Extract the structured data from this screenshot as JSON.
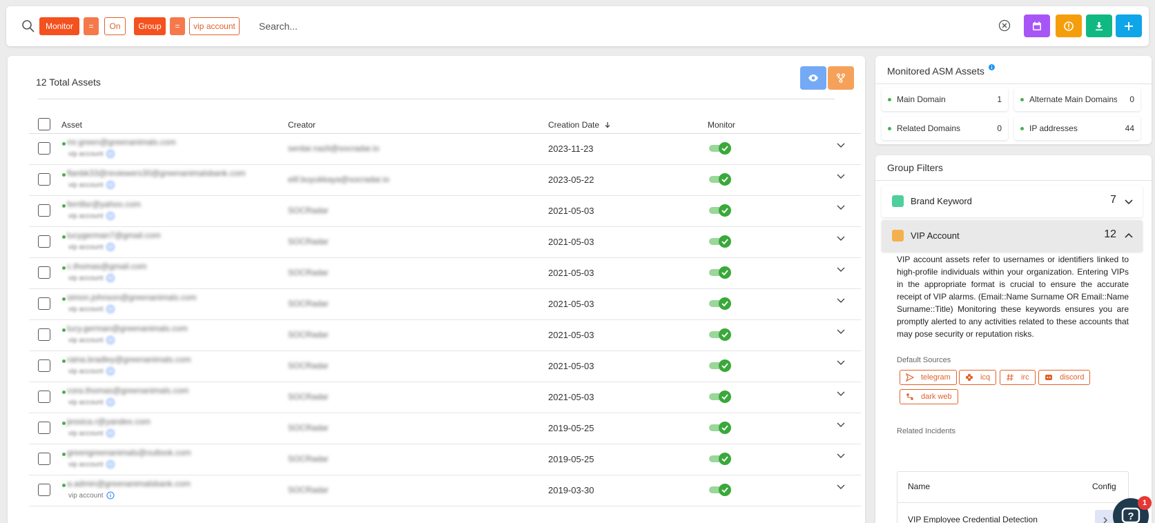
{
  "filter_bar": {
    "chips": [
      {
        "label": "Monitor",
        "style": "solid"
      },
      {
        "label": "=",
        "style": "eq"
      },
      {
        "label": "On",
        "style": "outline"
      },
      {
        "label": "Group",
        "style": "solid"
      },
      {
        "label": "=",
        "style": "eq"
      },
      {
        "label": "vip account",
        "style": "outline"
      }
    ],
    "search_placeholder": "Search...",
    "buttons": [
      {
        "name": "calendar-button",
        "icon": "calendar-icon",
        "color": "#a855f7"
      },
      {
        "name": "info-button",
        "icon": "info-icon",
        "color": "#f59e0b"
      },
      {
        "name": "download-button",
        "icon": "download-icon",
        "color": "#10b981"
      },
      {
        "name": "add-button",
        "icon": "plus-icon",
        "color": "#0ea5e9"
      }
    ]
  },
  "main": {
    "total_label": "12 Total Assets",
    "actions": [
      {
        "name": "view-button",
        "icon": "eye-icon",
        "color": "#74a9f5"
      },
      {
        "name": "branch-button",
        "icon": "fork-icon",
        "color": "#f6a15a"
      }
    ],
    "columns": {
      "asset": "Asset",
      "creator": "Creator",
      "creation_date": "Creation Date",
      "monitor": "Monitor"
    },
    "rows": [
      {
        "asset": "mr.green@greenanimals.com",
        "sub": "vip account",
        "creator": "serdar.nazli@socradar.io",
        "date": "2023-11-23"
      },
      {
        "asset": "flanbk33@reviewers30@greenanimalsbank.com",
        "sub": "vip account",
        "creator": "elif.buyukkaya@socradar.io",
        "date": "2023-05-22"
      },
      {
        "asset": "ferrillsr@yahoo.com",
        "sub": "vip account",
        "creator": "SOCRadar",
        "date": "2021-05-03"
      },
      {
        "asset": "lucygerman7@gmail.com",
        "sub": "vip account",
        "creator": "SOCRadar",
        "date": "2021-05-03"
      },
      {
        "asset": "c.thomas@gmail.com",
        "sub": "vip account",
        "creator": "SOCRadar",
        "date": "2021-05-03"
      },
      {
        "asset": "simon.johnson@greenanimals.com",
        "sub": "vip account",
        "creator": "SOCRadar",
        "date": "2021-05-03"
      },
      {
        "asset": "lucy.german@greenanimals.com",
        "sub": "vip account",
        "creator": "SOCRadar",
        "date": "2021-05-03"
      },
      {
        "asset": "raina.bradley@greenanimals.com",
        "sub": "vip account",
        "creator": "SOCRadar",
        "date": "2021-05-03"
      },
      {
        "asset": "cora.thomas@greenanimals.com",
        "sub": "vip account",
        "creator": "SOCRadar",
        "date": "2021-05-03"
      },
      {
        "asset": "jessica.r@yandex.com",
        "sub": "vip account",
        "creator": "SOCRadar",
        "date": "2019-05-25"
      },
      {
        "asset": "greengreenanimals@outlook.com",
        "sub": "vip account",
        "creator": "SOCRadar",
        "date": "2019-05-25"
      },
      {
        "asset": "a.admin@greenanimalsbank.com",
        "sub": "vip account",
        "creator": "SOCRadar",
        "date": "2019-03-30"
      }
    ]
  },
  "monitored": {
    "title": "Monitored ASM Assets",
    "stats": [
      {
        "label": "Main Domain",
        "value": "1"
      },
      {
        "label": "Alternate Main Domains",
        "value": "0"
      },
      {
        "label": "Related Domains",
        "value": "0"
      },
      {
        "label": "IP addresses",
        "value": "44"
      }
    ]
  },
  "group_filters": {
    "title": "Group Filters",
    "groups": [
      {
        "label": "Brand Keyword",
        "count": "7",
        "color": "#4fcf9b"
      },
      {
        "label": "VIP Account",
        "count": "12",
        "color": "#f5b04e"
      }
    ],
    "description": "VIP account assets refer to usernames or identifiers linked to high-profile individuals within your organization. Entering VIPs in the appropriate format is crucial to ensure the accurate receipt of VIP alarms. (Email::Name Surname OR Email::Name Surname::Title) Monitoring these keywords ensures you are promptly alerted to any activities related to these accounts that may pose security or reputation risks.",
    "default_sources_label": "Default Sources",
    "sources": [
      {
        "label": "telegram",
        "icon": "send-icon"
      },
      {
        "label": "icq",
        "icon": "flower-icon"
      },
      {
        "label": "irc",
        "icon": "hash-icon"
      },
      {
        "label": "discord",
        "icon": "discord-icon"
      },
      {
        "label": "dark web",
        "icon": "darkweb-icon"
      }
    ],
    "related_incidents_label": "Related Incidents",
    "incidents_table": {
      "name_header": "Name",
      "config_header": "Config",
      "rows": [
        {
          "name": "VIP Employee Credential Detection"
        }
      ]
    }
  },
  "help": {
    "badge_count": "1"
  }
}
